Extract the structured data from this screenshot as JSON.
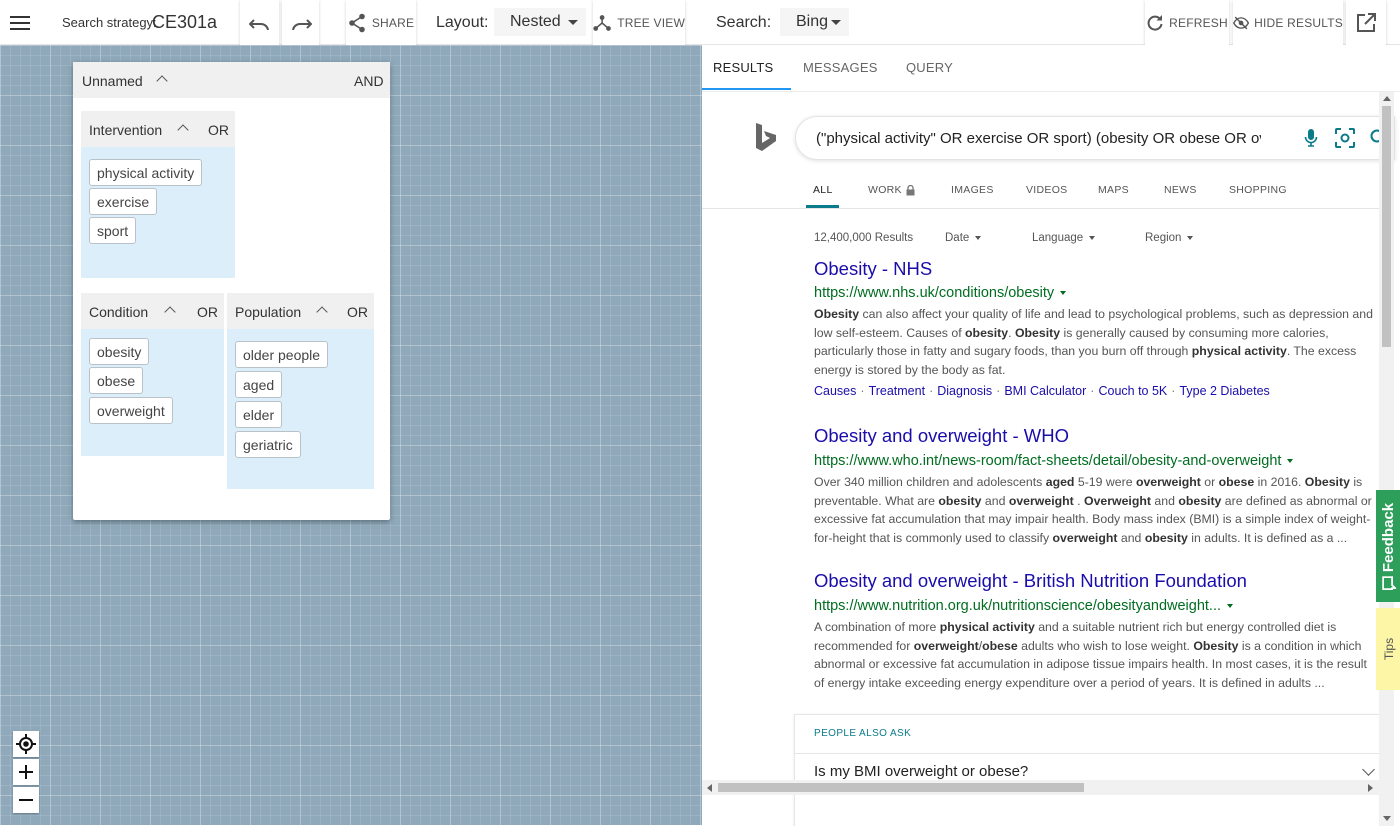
{
  "toolbar": {
    "strategy_label": "Search strategy:",
    "strategy_name": "CE301a",
    "share_label": "SHARE",
    "layout_label": "Layout:",
    "layout_value": "Nested",
    "tree_view_label": "TREE VIEW",
    "search_label": "Search:",
    "search_engine": "Bing",
    "refresh_label": "REFRESH",
    "hide_results_label": "HIDE RESULTS"
  },
  "strategy": {
    "name": "Unnamed",
    "operator": "AND",
    "groups": [
      {
        "name": "Intervention",
        "operator": "OR",
        "terms": [
          "physical activity",
          "exercise",
          "sport"
        ]
      },
      {
        "name": "Condition",
        "operator": "OR",
        "terms": [
          "obesity",
          "obese",
          "overweight"
        ]
      },
      {
        "name": "Population",
        "operator": "OR",
        "terms": [
          "older people",
          "aged",
          "elder",
          "geriatric"
        ]
      }
    ]
  },
  "right_tabs": [
    "RESULTS",
    "MESSAGES",
    "QUERY"
  ],
  "bing": {
    "query": "(\"physical activity\" OR exercise OR sport) (obesity OR obese OR overweight)",
    "nav": [
      "ALL",
      "WORK",
      "IMAGES",
      "VIDEOS",
      "MAPS",
      "NEWS",
      "SHOPPING"
    ],
    "result_count": "12,400,000 Results",
    "filters": [
      "Date",
      "Language",
      "Region"
    ],
    "results": [
      {
        "title": "Obesity - NHS",
        "url": "https://www.nhs.uk/conditions/obesity",
        "deeplinks": [
          "Causes",
          "Treatment",
          "Diagnosis",
          "BMI Calculator",
          "Couch to 5K",
          "Type 2 Diabetes"
        ]
      },
      {
        "title": "Obesity and overweight - WHO",
        "url": "https://www.who.int/news-room/fact-sheets/detail/obesity-and-overweight"
      },
      {
        "title": "Obesity and overweight - British Nutrition Foundation",
        "url": "https://www.nutrition.org.uk/nutritionscience/obesityandweight..."
      }
    ],
    "paa_label": "PEOPLE ALSO ASK",
    "paa_question": "Is my BMI overweight or obese?"
  },
  "side_tabs": {
    "feedback": "Feedback",
    "tips": "Tips"
  },
  "colors": {
    "canvas": "#8fa9bb",
    "group_bg": "#dbeefa",
    "link": "#1a0dab",
    "url": "#006d21",
    "feedback": "#2e9e5b",
    "tips": "#fdf6a6"
  }
}
